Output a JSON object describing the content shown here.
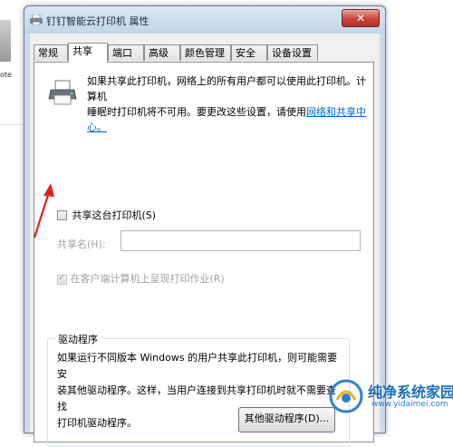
{
  "window": {
    "title": "钉钉智能云打印机 属性",
    "close_glyph": "✕"
  },
  "tabs": [
    {
      "label": "常规",
      "active": false
    },
    {
      "label": "共享",
      "active": true
    },
    {
      "label": "端口",
      "active": false
    },
    {
      "label": "高级",
      "active": false
    },
    {
      "label": "颜色管理",
      "active": false
    },
    {
      "label": "安全",
      "active": false
    },
    {
      "label": "设备设置",
      "active": false
    }
  ],
  "sharing": {
    "info_line1": "如果共享此打印机，网络上的所有用户都可以使用此打印机。计算机",
    "info_line2": "睡眠时打印机将不可用。要更改这些设置，请使用",
    "info_link": "网络和共享中心。",
    "share_label": "共享这台打印机(S)",
    "share_checked": false,
    "share_name_label": "共享名(H):",
    "share_name_value": "",
    "render_label": "在客户端计算机上呈现打印作业(R)",
    "render_checked": true
  },
  "drivers": {
    "title": "驱动程序",
    "text_line1": "如果运行不同版本 Windows 的用户共享此打印机，则可能需要安",
    "text_line2": "装其他驱动程序。这样，当用户连接到共享打印机时就不需要查找",
    "text_line3": "打印机驱动程序。",
    "button_label": "其他驱动程序(D)..."
  },
  "background": {
    "desktop_label": "ote"
  },
  "watermark": {
    "name": "纯净系统家园",
    "url": "www.yidaimei.com"
  },
  "colors": {
    "accent_link": "#0066cc",
    "arrow": "#e02020",
    "close_button": "#c7453a"
  }
}
